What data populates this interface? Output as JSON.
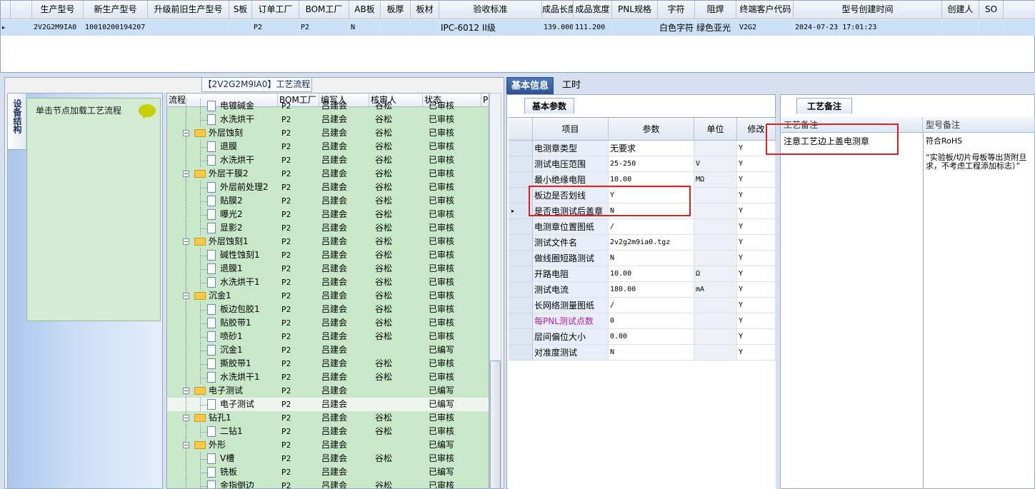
{
  "top_grid": {
    "columns": [
      "生产型号",
      "新生产型号",
      "升级前旧生产型号",
      "S板",
      "订单工厂",
      "BOM工厂",
      "AB板",
      "板厚",
      "板材",
      "验收标准",
      "成品长度",
      "成品宽度",
      "PNL规格",
      "字符",
      "阻焊",
      "终端客户代码",
      "型号创建时间",
      "创建人",
      "SO"
    ],
    "row": [
      "2V2G2M9IA0",
      "10010200194207",
      "",
      "",
      "P2",
      "P2",
      "N",
      "",
      "",
      "IPC-6012 II级",
      "139.000",
      "111.200",
      "",
      "白色字符",
      "绿色亚光",
      "V2G2",
      "2024-07-23 17:01:23",
      "",
      ""
    ],
    "row_pointer": "▸"
  },
  "left_panel": {
    "title": "【2V2G2M9IA0】工艺流程",
    "vertical_tab": "设备结构",
    "node_hint": "单击节点加载工艺流程"
  },
  "tree": {
    "columns": [
      "流程",
      "BOM工厂",
      "编写人",
      "核审人",
      "状态",
      "P"
    ],
    "rows": [
      {
        "level": 2,
        "type": "doc",
        "name": "电镀碱金",
        "factory": "P2",
        "writer": "吕建会",
        "reviewer": "谷松",
        "status": "已审核"
      },
      {
        "level": 2,
        "type": "doc",
        "name": "水洗烘干",
        "factory": "P2",
        "writer": "吕建会",
        "reviewer": "谷松",
        "status": "已审核"
      },
      {
        "level": 1,
        "type": "folder",
        "name": "外层蚀刻",
        "factory": "P2",
        "writer": "吕建会",
        "reviewer": "谷松",
        "status": "已审核"
      },
      {
        "level": 2,
        "type": "doc",
        "name": "退膜",
        "factory": "P2",
        "writer": "吕建会",
        "reviewer": "谷松",
        "status": "已审核"
      },
      {
        "level": 2,
        "type": "doc",
        "name": "水洗烘干",
        "factory": "P2",
        "writer": "吕建会",
        "reviewer": "谷松",
        "status": "已审核"
      },
      {
        "level": 1,
        "type": "folder",
        "name": "外层干膜2",
        "factory": "P2",
        "writer": "吕建会",
        "reviewer": "谷松",
        "status": "已审核"
      },
      {
        "level": 2,
        "type": "doc",
        "name": "外层前处理2",
        "factory": "P2",
        "writer": "吕建会",
        "reviewer": "谷松",
        "status": "已审核"
      },
      {
        "level": 2,
        "type": "doc",
        "name": "贴膜2",
        "factory": "P2",
        "writer": "吕建会",
        "reviewer": "谷松",
        "status": "已审核"
      },
      {
        "level": 2,
        "type": "doc",
        "name": "曝光2",
        "factory": "P2",
        "writer": "吕建会",
        "reviewer": "谷松",
        "status": "已审核"
      },
      {
        "level": 2,
        "type": "doc",
        "name": "显影2",
        "factory": "P2",
        "writer": "吕建会",
        "reviewer": "谷松",
        "status": "已审核"
      },
      {
        "level": 1,
        "type": "folder",
        "name": "外层蚀刻1",
        "factory": "P2",
        "writer": "吕建会",
        "reviewer": "谷松",
        "status": "已审核"
      },
      {
        "level": 2,
        "type": "doc",
        "name": "碱性蚀刻1",
        "factory": "P2",
        "writer": "吕建会",
        "reviewer": "谷松",
        "status": "已审核"
      },
      {
        "level": 2,
        "type": "doc",
        "name": "退膜1",
        "factory": "P2",
        "writer": "吕建会",
        "reviewer": "谷松",
        "status": "已审核"
      },
      {
        "level": 2,
        "type": "doc",
        "name": "水洗烘干1",
        "factory": "P2",
        "writer": "吕建会",
        "reviewer": "谷松",
        "status": "已审核"
      },
      {
        "level": 1,
        "type": "folder",
        "name": "沉金1",
        "factory": "P2",
        "writer": "吕建会",
        "reviewer": "谷松",
        "status": "已审核"
      },
      {
        "level": 2,
        "type": "doc",
        "name": "板边包胶1",
        "factory": "P2",
        "writer": "吕建会",
        "reviewer": "谷松",
        "status": "已审核"
      },
      {
        "level": 2,
        "type": "doc",
        "name": "贴胶带1",
        "factory": "P2",
        "writer": "吕建会",
        "reviewer": "谷松",
        "status": "已审核"
      },
      {
        "level": 2,
        "type": "doc",
        "name": "喷砂1",
        "factory": "P2",
        "writer": "吕建会",
        "reviewer": "谷松",
        "status": "已审核"
      },
      {
        "level": 2,
        "type": "doc",
        "name": "沉金1",
        "factory": "P2",
        "writer": "吕建会",
        "reviewer": "",
        "status": "已编写"
      },
      {
        "level": 2,
        "type": "doc",
        "name": "撕胶带1",
        "factory": "P2",
        "writer": "吕建会",
        "reviewer": "谷松",
        "status": "已审核"
      },
      {
        "level": 2,
        "type": "doc",
        "name": "水洗烘干1",
        "factory": "P2",
        "writer": "吕建会",
        "reviewer": "谷松",
        "status": "已审核"
      },
      {
        "level": 1,
        "type": "folder",
        "name": "电子测试",
        "factory": "P2",
        "writer": "吕建会",
        "reviewer": "",
        "status": "已编写"
      },
      {
        "level": 2,
        "type": "doc",
        "name": "电子测试",
        "factory": "P2",
        "writer": "吕建会",
        "reviewer": "",
        "status": "已编写",
        "selected": true
      },
      {
        "level": 1,
        "type": "folder",
        "name": "钻孔1",
        "factory": "P2",
        "writer": "吕建会",
        "reviewer": "谷松",
        "status": "已审核"
      },
      {
        "level": 2,
        "type": "doc",
        "name": "二钻1",
        "factory": "P2",
        "writer": "吕建会",
        "reviewer": "谷松",
        "status": "已审核"
      },
      {
        "level": 1,
        "type": "folder",
        "name": "外形",
        "factory": "P2",
        "writer": "吕建会",
        "reviewer": "",
        "status": "已编写"
      },
      {
        "level": 2,
        "type": "doc",
        "name": "V槽",
        "factory": "P2",
        "writer": "吕建会",
        "reviewer": "谷松",
        "status": "已审核"
      },
      {
        "level": 2,
        "type": "doc",
        "name": "铣板",
        "factory": "P2",
        "writer": "吕建会",
        "reviewer": "",
        "status": "已编写"
      },
      {
        "level": 2,
        "type": "doc",
        "name": "金指倒边",
        "factory": "P2",
        "writer": "吕建会",
        "reviewer": "谷松",
        "status": "已审核"
      }
    ]
  },
  "middle": {
    "tabs": [
      "基本信息",
      "工时"
    ],
    "subtab": "基本参数",
    "columns": [
      "项目",
      "参数",
      "单位",
      "修改"
    ],
    "rows": [
      {
        "item": "电测章类型",
        "param": "无要求",
        "unit": "",
        "mod": "Y"
      },
      {
        "item": "测试电压范围",
        "param": "25-250",
        "unit": "V",
        "mod": "Y"
      },
      {
        "item": "最小绝缘电阻",
        "param": "10.00",
        "unit": "MΩ",
        "mod": "Y"
      },
      {
        "item": "板边是否划线",
        "param": "Y",
        "unit": "",
        "mod": "Y"
      },
      {
        "item": "是否电测试后盖章",
        "param": "N",
        "unit": "",
        "mod": "Y",
        "current": true
      },
      {
        "item": "电测章位置图纸",
        "param": "/",
        "unit": "",
        "mod": "Y"
      },
      {
        "item": "测试文件名",
        "param": "2v2g2m9ia0.tgz",
        "unit": "",
        "mod": "Y"
      },
      {
        "item": "做线圈短路测试",
        "param": "N",
        "unit": "",
        "mod": "Y"
      },
      {
        "item": "开路电阻",
        "param": "10.00",
        "unit": "Ω",
        "mod": "Y"
      },
      {
        "item": "测试电流",
        "param": "180.00",
        "unit": "mA",
        "mod": "Y"
      },
      {
        "item": "长网络测量图纸",
        "param": "/",
        "unit": "",
        "mod": "Y"
      },
      {
        "item": "每PNL测试点数",
        "param": "0",
        "unit": "",
        "mod": "Y",
        "highlight": "#b0209a"
      },
      {
        "item": "层间偏位大小",
        "param": "0.00",
        "unit": "",
        "mod": "Y"
      },
      {
        "item": "对准度测试",
        "param": "N",
        "unit": "",
        "mod": "Y"
      }
    ],
    "row_pointer": "▸"
  },
  "right": {
    "subtab": "工艺备注",
    "columns": [
      "工艺备注",
      "型号备注"
    ],
    "process_note": "注意工艺边上盖电测章",
    "model_note_lines": [
      "符合RoHS",
      "“实验板/切片母板等出货附旦",
      "求，不考虑工程添加标志）”"
    ]
  },
  "colors": {
    "accent": "#2f5597",
    "tree_bg": "#c9e8c9",
    "selected_row": "#c9e0f7",
    "annotation_red": "#e02020"
  }
}
